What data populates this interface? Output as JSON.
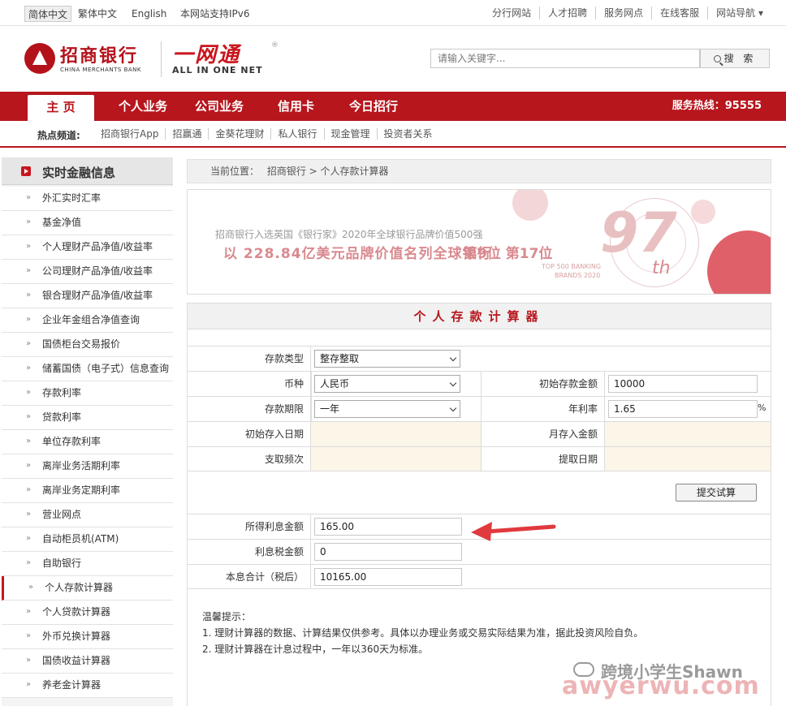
{
  "topbar": {
    "langs": [
      "简体中文",
      "繁体中文",
      "English"
    ],
    "ipv6": "本网站支持IPv6",
    "links": [
      "分行网站",
      "人才招聘",
      "服务网点",
      "在线客服",
      "网站导航"
    ]
  },
  "header": {
    "logo_cn": "招商银行",
    "logo_en": "CHINA MERCHANTS BANK",
    "product": "一网通",
    "product_en": "ALL IN ONE NET",
    "search_placeholder": "请输入关键字...",
    "search_button": "搜 索"
  },
  "nav": {
    "items": [
      "主 页",
      "个人业务",
      "公司业务",
      "信用卡",
      "今日招行"
    ],
    "hotline": "服务热线：95555"
  },
  "subnav": {
    "label": "热点频道:",
    "links": [
      "招商银行App",
      "招赢通",
      "金葵花理财",
      "私人银行",
      "现金管理",
      "投资者关系"
    ]
  },
  "sidebar": {
    "title": "实时金融信息",
    "items": [
      "外汇实时汇率",
      "基金净值",
      "个人理财产品净值/收益率",
      "公司理财产品净值/收益率",
      "银合理财产品净值/收益率",
      "企业年金组合净值查询",
      "国债柜台交易报价",
      "储蓄国债（电子式）信息查询",
      "存款利率",
      "贷款利率",
      "单位存款利率",
      "离岸业务活期利率",
      "离岸业务定期利率",
      "营业网点",
      "自动柜员机(ATM)",
      "自助银行",
      "个人存款计算器",
      "个人贷款计算器",
      "外币兑换计算器",
      "国债收益计算器",
      "养老金计算器"
    ],
    "active_index": 16
  },
  "breadcrumb": {
    "label": "当前位置：",
    "path": "招商银行 > 个人存款计算器"
  },
  "banner": {
    "line1": "招商银行入选英国《银行家》2020年全球银行品牌价值500强",
    "line2": "以 228.84亿美元品牌价值名列全球银行",
    "rank": "第9位 第17位",
    "top500": "TOP 500 BANKING",
    "brands": "BRANDS 2020",
    "big_num": "97",
    "th": "th"
  },
  "calculator": {
    "title": "个人存款计算器",
    "deposit_type_label": "存款类型",
    "deposit_type_value": "整存整取",
    "currency_label": "币种",
    "currency_value": "人民币",
    "initial_amount_label": "初始存款金额",
    "initial_amount_value": "10000",
    "term_label": "存款期限",
    "term_value": "一年",
    "rate_label": "年利率",
    "rate_value": "1.65",
    "rate_unit": "%",
    "initial_date_label": "初始存入日期",
    "monthly_amount_label": "月存入金额",
    "withdraw_freq_label": "支取频次",
    "withdraw_date_label": "提取日期",
    "submit_label": "提交试算",
    "interest_label": "所得利息金额",
    "interest_value": "165.00",
    "tax_label": "利息税金额",
    "tax_value": "0",
    "total_label": "本息合计（税后）",
    "total_value": "10165.00",
    "tips_title": "温馨提示：",
    "tips": [
      "1. 理财计算器的数据、计算结果仅供参考。具体以办理业务或交易实际结果为准，据此投资风险自负。",
      "2. 理财计算器在计息过程中，一年以360天为标准。"
    ]
  },
  "watermark": {
    "line1": "跨境小学生Shawn",
    "line2": "awyerwu.com"
  }
}
